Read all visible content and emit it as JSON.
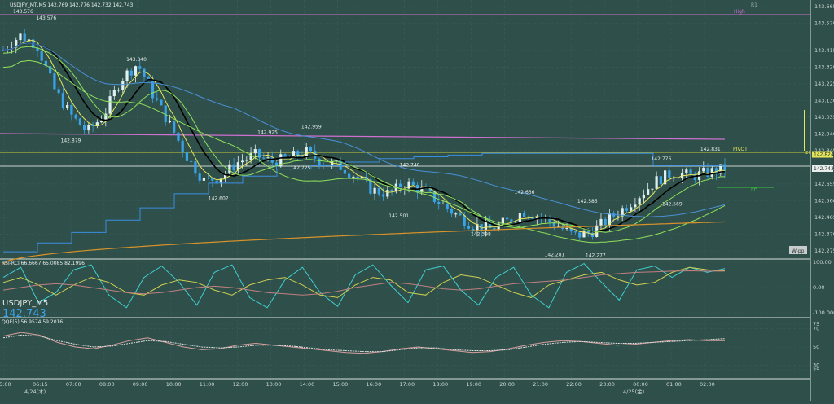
{
  "window": {
    "symbol_line": "USDJPY_MT,M5  142.769 142.776 142.732 142.743",
    "big_symbol": "USDJPY_M5",
    "big_price": "142.743"
  },
  "colors": {
    "background": "#2f4f4a",
    "candle_up": "#dff0f2",
    "candle_down": "#3aa3e8",
    "ma_black": "#000000",
    "ma_yellow": "#e6e65a",
    "ma_green": "#8fe05a",
    "ma_blue": "#4a90d9",
    "ma_orange": "#d9932a",
    "pivot_line": "#c8c83a",
    "r1_line": "#d070d0",
    "current_price_line": "#ffffff"
  },
  "main_price_labels": {
    "top_left": "143.576",
    "high_label": "High",
    "r1_label": "R1",
    "pivot_label": "PIVOT",
    "pp_label": "PP",
    "wpp_label": "W-pp",
    "side_20": "20",
    "current_price_tag": "142.743",
    "pivot_tag": "142.824"
  },
  "swing_labels": [
    {
      "text": "143.576"
    },
    {
      "text": "143.340"
    },
    {
      "text": "142.879"
    },
    {
      "text": "142.602"
    },
    {
      "text": "142.925"
    },
    {
      "text": "142.959"
    },
    {
      "text": "142.725"
    },
    {
      "text": "142.740"
    },
    {
      "text": "142.501"
    },
    {
      "text": "142.636"
    },
    {
      "text": "142.398"
    },
    {
      "text": "142.281"
    },
    {
      "text": "142.585"
    },
    {
      "text": "142.277"
    },
    {
      "text": "142.776"
    },
    {
      "text": "142.831"
    },
    {
      "text": "142.569"
    }
  ],
  "main_axis_ticks": [
    "143.665",
    "143.570",
    "143.415",
    "143.320",
    "143.225",
    "143.130",
    "143.035",
    "142.940",
    "142.845",
    "142.743",
    "142.655",
    "142.560",
    "142.465",
    "142.370",
    "142.275"
  ],
  "time_ticks": [
    "5:00",
    "06:15",
    "07:00",
    "08:00",
    "09:00",
    "10:00",
    "11:00",
    "12:00",
    "13:00",
    "14:00",
    "15:00",
    "16:00",
    "17:00",
    "18:00",
    "19:00",
    "20:00",
    "21:00",
    "22:00",
    "23:00",
    "00:00",
    "01:00",
    "02:00"
  ],
  "date_labels": [
    "4/24(木)",
    "4/25(金)"
  ],
  "indicator1": {
    "title": "RSI-RCI 66.6667 65.0085 82.1996",
    "axis": [
      "100.00",
      "0.00",
      "-100.0000"
    ]
  },
  "indicator2": {
    "title": "QQE(5) 56.9574 59.2016",
    "axis": [
      "75",
      "70",
      "50",
      "30",
      "25"
    ]
  },
  "chart_data": [
    {
      "type": "candlestick",
      "title": "USDJPY_MT,M5",
      "ylim": [
        142.275,
        143.665
      ],
      "x_time_range": [
        "05:00",
        "02:55"
      ],
      "swing_points": [
        {
          "x": "06:15",
          "y": 143.576
        },
        {
          "x": "09:00",
          "y": 143.34
        },
        {
          "x": "07:00",
          "y": 142.879
        },
        {
          "x": "11:30",
          "y": 142.602
        },
        {
          "x": "13:00",
          "y": 142.925
        },
        {
          "x": "14:20",
          "y": 142.959
        },
        {
          "x": "14:00",
          "y": 142.725
        },
        {
          "x": "17:20",
          "y": 142.74
        },
        {
          "x": "17:00",
          "y": 142.501
        },
        {
          "x": "20:50",
          "y": 142.636
        },
        {
          "x": "19:30",
          "y": 142.398
        },
        {
          "x": "21:45",
          "y": 142.281
        },
        {
          "x": "22:45",
          "y": 142.585
        },
        {
          "x": "23:00",
          "y": 142.277
        },
        {
          "x": "01:00",
          "y": 142.776
        },
        {
          "x": "02:30",
          "y": 142.831
        },
        {
          "x": "01:20",
          "y": 142.569
        }
      ],
      "close_path": [
        143.42,
        143.5,
        143.45,
        143.2,
        143.05,
        142.95,
        143.05,
        143.25,
        143.34,
        143.15,
        142.98,
        142.8,
        142.67,
        142.7,
        142.78,
        142.82,
        142.78,
        142.8,
        142.84,
        142.78,
        142.76,
        142.7,
        142.62,
        142.6,
        142.66,
        142.62,
        142.55,
        142.48,
        142.42,
        142.4,
        142.44,
        142.5,
        142.47,
        142.42,
        142.36,
        142.38,
        142.45,
        142.52,
        142.6,
        142.68,
        142.72,
        142.7,
        142.72,
        142.743
      ],
      "horizontal_levels": [
        {
          "name": "PIVOT",
          "value": 142.824
        },
        {
          "name": "current",
          "value": 142.743
        },
        {
          "name": "PP",
          "value": 142.655
        }
      ]
    },
    {
      "type": "line",
      "title": "RSI-RCI 66.6667 65.0085 82.1996",
      "ylim": [
        -100,
        100
      ],
      "series": [
        {
          "values": [
            40,
            80,
            -60,
            -20,
            70,
            90,
            -30,
            -80,
            40,
            85,
            20,
            -70,
            60,
            90,
            -40,
            -80,
            30,
            80,
            -20,
            -75,
            50,
            90,
            10,
            -60,
            70,
            85,
            -10,
            -70,
            40,
            80,
            -30,
            -80,
            60,
            95,
            20,
            -50,
            70,
            85,
            40,
            80,
            60,
            75
          ]
        },
        {
          "values": [
            20,
            40,
            10,
            -30,
            10,
            40,
            20,
            -20,
            -30,
            10,
            30,
            20,
            -10,
            -30,
            10,
            30,
            40,
            10,
            -30,
            -40,
            10,
            40,
            30,
            -20,
            -30,
            20,
            50,
            40,
            10,
            -20,
            -40,
            10,
            30,
            50,
            60,
            30,
            10,
            20,
            60,
            80,
            70,
            66
          ]
        },
        {
          "values": [
            -10,
            0,
            10,
            15,
            10,
            0,
            -10,
            -20,
            -25,
            -20,
            -10,
            0,
            5,
            0,
            -10,
            -20,
            -25,
            -30,
            -25,
            -15,
            0,
            10,
            20,
            15,
            5,
            -5,
            -10,
            -5,
            5,
            15,
            20,
            25,
            30,
            40,
            50,
            55,
            60,
            62,
            65,
            66,
            65,
            65
          ]
        }
      ]
    },
    {
      "type": "line",
      "title": "QQE(5) 56.9574 59.2016",
      "ylim": [
        25,
        75
      ],
      "series": [
        {
          "values": [
            62,
            66,
            63,
            55,
            50,
            48,
            52,
            57,
            60,
            55,
            50,
            47,
            48,
            52,
            54,
            52,
            50,
            48,
            46,
            44,
            43,
            45,
            48,
            50,
            48,
            46,
            44,
            45,
            48,
            52,
            55,
            57,
            56,
            54,
            52,
            53,
            55,
            57,
            58,
            57,
            56.96
          ]
        },
        {
          "values": [
            60,
            63,
            62,
            57,
            53,
            50,
            51,
            54,
            57,
            56,
            53,
            50,
            49,
            50,
            52,
            52,
            51,
            49,
            47,
            46,
            45,
            45,
            47,
            49,
            49,
            47,
            46,
            46,
            47,
            50,
            53,
            55,
            56,
            55,
            54,
            54,
            55,
            56,
            57,
            58,
            59.2
          ]
        }
      ]
    }
  ]
}
